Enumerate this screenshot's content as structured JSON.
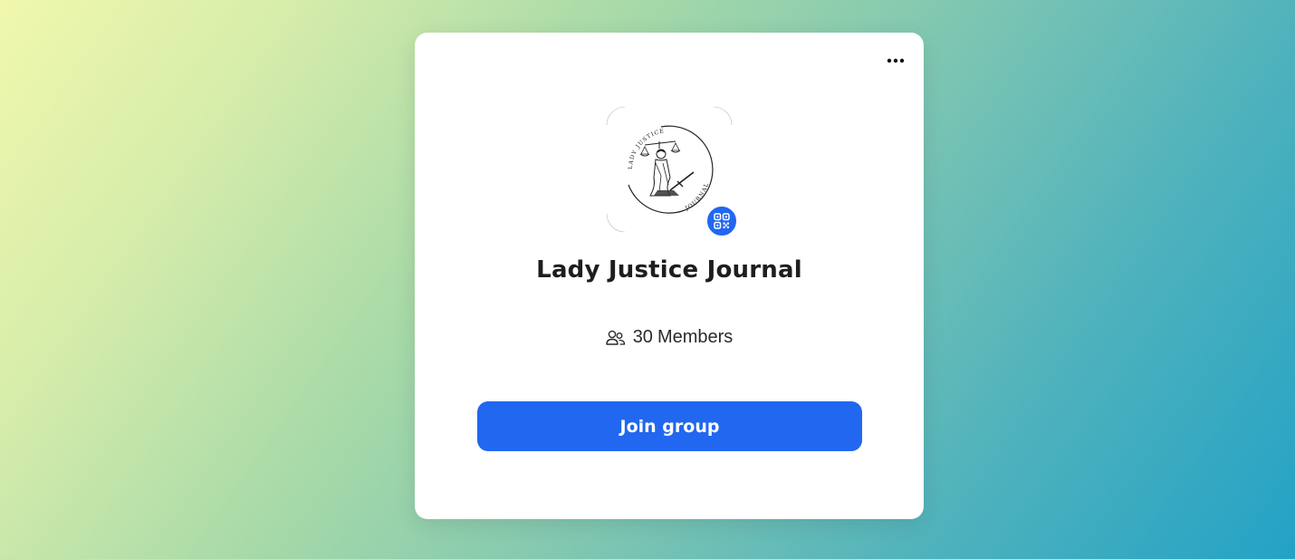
{
  "group": {
    "name": "Lady Justice Journal",
    "member_count": "30",
    "member_label": "Members",
    "logo_text_top": "LADY JUSTICE",
    "logo_text_bottom": "JOURNAL"
  },
  "actions": {
    "join_label": "Join group"
  },
  "icons": {
    "more": "more-horizontal-icon",
    "qr": "qr-code-icon",
    "members": "users-icon"
  },
  "colors": {
    "accent": "#2167f0",
    "card": "#ffffff",
    "text": "#1e1e1e"
  }
}
